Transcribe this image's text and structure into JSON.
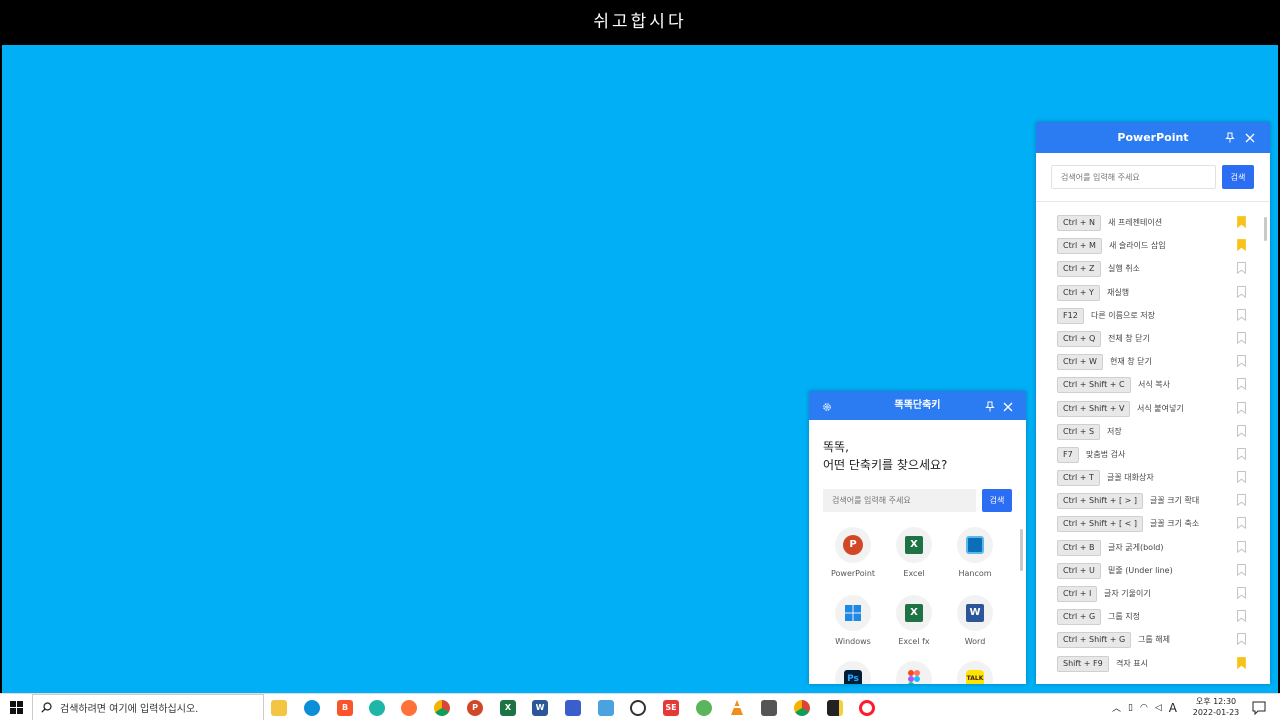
{
  "banner": {
    "text": "쉬고합시다"
  },
  "ppt_panel": {
    "title": "PowerPoint",
    "search_placeholder": "검색어를 입력해 주세요",
    "search_button": "검색",
    "shortcuts": [
      {
        "key": "Ctrl + N",
        "desc": "새 프레젠테이션",
        "bookmarked": true
      },
      {
        "key": "Ctrl + M",
        "desc": "새 슬라이드 삽입",
        "bookmarked": true
      },
      {
        "key": "Ctrl + Z",
        "desc": "실행 취소",
        "bookmarked": false
      },
      {
        "key": "Ctrl + Y",
        "desc": "재실행",
        "bookmarked": false
      },
      {
        "key": "F12",
        "desc": "다른 이름으로 저장",
        "bookmarked": false
      },
      {
        "key": "Ctrl + Q",
        "desc": "전체 창 닫기",
        "bookmarked": false
      },
      {
        "key": "Ctrl + W",
        "desc": "현재 창 닫기",
        "bookmarked": false
      },
      {
        "key": "Ctrl + Shift + C",
        "desc": "서식 복사",
        "bookmarked": false
      },
      {
        "key": "Ctrl + Shift + V",
        "desc": "서식 붙여넣기",
        "bookmarked": false
      },
      {
        "key": "Ctrl + S",
        "desc": "저장",
        "bookmarked": false
      },
      {
        "key": "F7",
        "desc": "맞춤법 검사",
        "bookmarked": false
      },
      {
        "key": "Ctrl + T",
        "desc": "글꼴 대화상자",
        "bookmarked": false
      },
      {
        "key": "Ctrl + Shift + [ > ]",
        "desc": "글꼴 크기 확대",
        "bookmarked": false
      },
      {
        "key": "Ctrl + Shift + [ < ]",
        "desc": "글꼴 크기 축소",
        "bookmarked": false
      },
      {
        "key": "Ctrl + B",
        "desc": "글자 굵게(bold)",
        "bookmarked": false
      },
      {
        "key": "Ctrl + U",
        "desc": "밑줄 (Under line)",
        "bookmarked": false
      },
      {
        "key": "Ctrl + I",
        "desc": "글자 기울이기",
        "bookmarked": false
      },
      {
        "key": "Ctrl + G",
        "desc": "그룹 지정",
        "bookmarked": false
      },
      {
        "key": "Ctrl + Shift + G",
        "desc": "그룹 해제",
        "bookmarked": false
      },
      {
        "key": "Shift + F9",
        "desc": "격자 표시",
        "bookmarked": true
      }
    ]
  },
  "shortcut_panel": {
    "title": "똑똑단축키",
    "greeting_line1": "똑똑,",
    "greeting_line2": "어떤 단축키를 찾으세요?",
    "search_placeholder": "검색어를 입력해 주세요",
    "search_button": "검색",
    "apps": [
      {
        "label": "PowerPoint",
        "icon": "powerpoint-icon"
      },
      {
        "label": "Excel",
        "icon": "excel-icon"
      },
      {
        "label": "Hancom",
        "icon": "hancom-icon"
      },
      {
        "label": "Windows",
        "icon": "windows-icon"
      },
      {
        "label": "Excel fx",
        "icon": "excel-fx-icon"
      },
      {
        "label": "Word",
        "icon": "word-icon"
      },
      {
        "label": "",
        "icon": "photoshop-icon"
      },
      {
        "label": "",
        "icon": "figma-icon"
      },
      {
        "label": "",
        "icon": "kakaotalk-icon"
      }
    ]
  },
  "taskbar": {
    "search_text": "검색하려면 여기에 입력하십시오.",
    "clock_line1": "오후 12:30",
    "clock_line2": "2022-01-23",
    "ime": "A"
  },
  "colors": {
    "desktop": "#00aff5",
    "panel_header": "#2b7cf3",
    "search_button": "#2b6ef3",
    "bookmark_active": "#f7c31a"
  }
}
